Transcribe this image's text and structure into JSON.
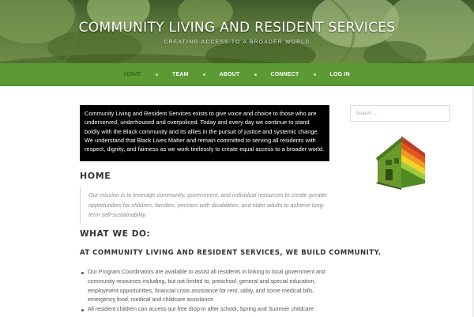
{
  "header": {
    "site_title": "COMMUNITY LIVING AND RESIDENT SERVICES",
    "tagline": "CREATING ACCESS TO A BROADER WORLD"
  },
  "nav": {
    "items": [
      {
        "label": "HOME",
        "active": true
      },
      {
        "label": "TEAM",
        "active": false
      },
      {
        "label": "ABOUT",
        "active": false
      },
      {
        "label": "CONNECT",
        "active": false
      },
      {
        "label": "LOG IN",
        "active": false
      }
    ]
  },
  "main": {
    "mission_statement": "Community Living and Resident Services exists to give voice and choice to those who are underserved, underhoused and overpoliced. Today and every day we continue to stand boldly with the Black community and its allies in the pursuit of justice and systemic change. We understand that Black Lives Matter and remain committed to serving all residents with respect, dignity, and fairness as we work tirelessly to create equal access to a broader world.",
    "home_heading": "HOME",
    "quote": "Our mission is to leverage community, government, and individual resources to create greater opportunities for children, families, persons with disabilities, and older adults to achieve long-term self-sustainability.",
    "what_we_do_heading": "WHAT WE DO:",
    "subheading": "AT COMMUNITY LIVING AND RESIDENT SERVICES, WE BUILD COMMUNITY.",
    "bullets": [
      "Our Program Coordinators are available to assist all residents in linking to local government and community resources including, but not limited to, preschool, general and special education, employment opportunities, financial crisis assistance for rent, utility, and some medical bills, emergency food, medical and childcare assistance.",
      "All resident children can access our free drop-in after school, Spring and Summer childcare"
    ]
  },
  "sidebar": {
    "search_placeholder": "Search …",
    "image": "green-house-energy-rating-illustration"
  },
  "colors": {
    "nav_green": "#5c9a34",
    "mission_box_bg": "#000000",
    "nav_active": "#2f5a14"
  }
}
